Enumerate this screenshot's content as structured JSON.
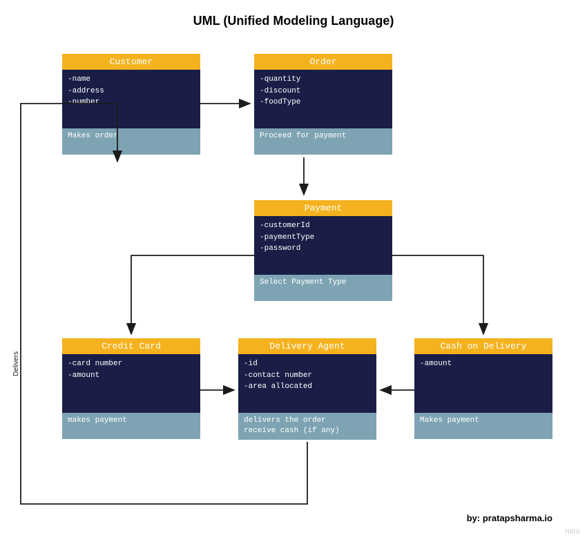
{
  "title": "UML (Unified Modeling Language)",
  "attribution": "by: pratapsharma.io",
  "miro": "miro",
  "delivers_label": "Delivers",
  "boxes": {
    "customer": {
      "title": "Customer",
      "attributes": "-name\n-address\n-number",
      "methods": "Makes order"
    },
    "order": {
      "title": "Order",
      "attributes": "-quantity\n-discount\n-foodType",
      "methods": "Proceed for payment"
    },
    "payment": {
      "title": "Payment",
      "attributes": "-customerId\n-paymentType\n-password",
      "methods": "Select Payment Type"
    },
    "credit_card": {
      "title": "Credit Card",
      "attributes": "-card number\n-amount",
      "methods": "makes payment"
    },
    "delivery_agent": {
      "title": "Delivery Agent",
      "attributes": "-id\n-contact number\n-area allocated",
      "methods": "delivers the order\nreceive cash (if any)"
    },
    "cash_on_delivery": {
      "title": "Cash on Delivery",
      "attributes": "-amount",
      "methods": "Makes payment"
    }
  }
}
